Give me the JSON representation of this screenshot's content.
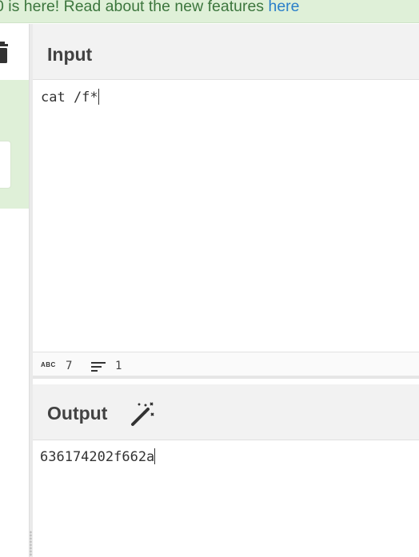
{
  "banner": {
    "text": "0 is here! Read about the new features ",
    "link_label": "here"
  },
  "input_panel": {
    "title": "Input",
    "value": "cat /f*"
  },
  "status_bar": {
    "abc_label": "ABC",
    "char_count": "7",
    "line_count": "1"
  },
  "output_panel": {
    "title": "Output",
    "value": "636174202f662a"
  },
  "icons": {
    "trash": "trash-icon",
    "wand": "magic-wand-icon",
    "lines": "lines-icon"
  },
  "colors": {
    "banner_bg": "#dff0d8",
    "banner_text": "#3c763d",
    "link": "#2a7fc9",
    "panel_head_bg": "#f2f2f2"
  }
}
